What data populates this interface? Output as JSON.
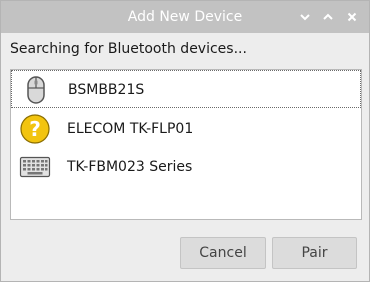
{
  "window": {
    "title": "Add New Device",
    "controls": [
      "minimize-icon",
      "maximize-icon",
      "close-icon"
    ]
  },
  "status_text": "Searching for Bluetooth devices...",
  "devices": [
    {
      "name": "BSMBB21S",
      "icon": "mouse-icon",
      "selected": true
    },
    {
      "name": "ELECOM TK-FLP01",
      "icon": "unknown-device-icon",
      "selected": false
    },
    {
      "name": "TK-FBM023 Series",
      "icon": "keyboard-icon",
      "selected": false
    }
  ],
  "buttons": {
    "cancel_label": "Cancel",
    "pair_label": "Pair"
  },
  "colors": {
    "titlebar": "#c2c2c2",
    "unknown_icon": "#f2c40f"
  }
}
